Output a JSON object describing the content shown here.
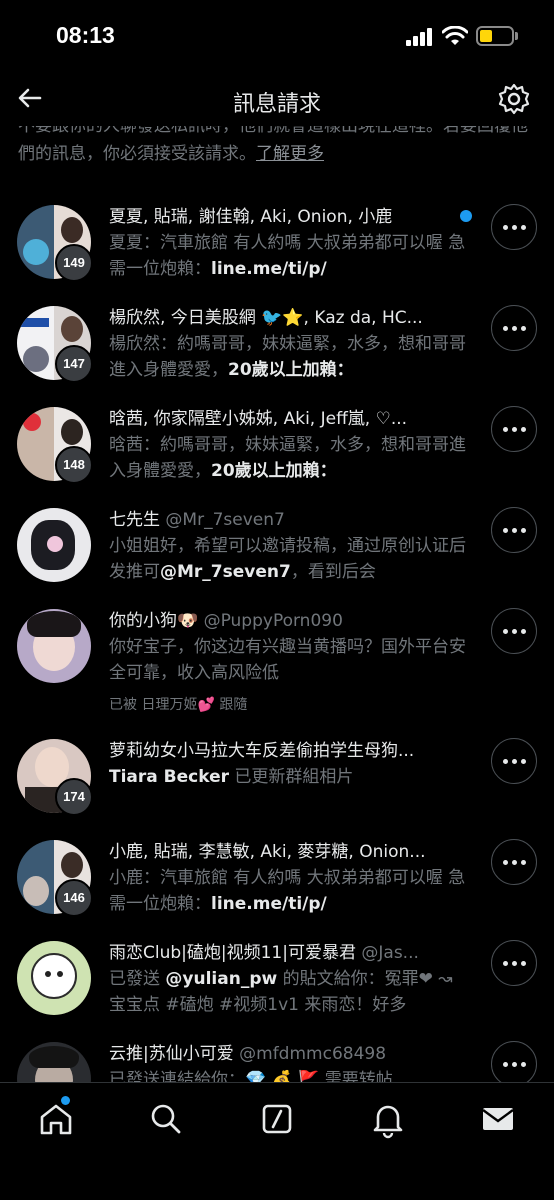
{
  "status_bar": {
    "time": "08:13"
  },
  "header": {
    "title": "訊息請求"
  },
  "notice": {
    "text": "不要跟你的人聊發送私訊時，他們就會這樣出現在這裡。若要回覆他們的訊息，你必須接受該請求。",
    "link": "了解更多"
  },
  "requests": [
    {
      "title": "夏夏, 貼瑞, 謝佳翰, Aki, Onion, 小鹿",
      "message_prefix": "夏夏：汽車旅館 有人約嗎 大叔弟弟都可以喔 急需一位炮賴：",
      "message_link": "line.me/ti/p/",
      "count": "149",
      "unread": true
    },
    {
      "title": "楊欣然, 今日美股網 🐦⭐, Kaz da, HC...",
      "message_prefix": "楊欣然：約嗎哥哥，妹妹逼緊，水多，想和哥哥進入身體愛愛，",
      "message_link": "20歲以上加賴：",
      "count": "147"
    },
    {
      "title": "晗茜, 你家隔壁小姊姊, Aki, Jeff嵐, ♡...",
      "message_prefix": "晗茜：約嗎哥哥，妹妹逼緊，水多，想和哥哥進入身體愛愛，",
      "message_link": "20歲以上加賴：",
      "count": "148"
    },
    {
      "title": "七先生",
      "handle": "@Mr_7seven7",
      "message_prefix": "小姐姐好，希望可以邀请投稿，通过原创认证后发推可",
      "message_link": "@Mr_7seven7",
      "message_suffix": "，看到后会"
    },
    {
      "title": "你的小狗🐶",
      "handle": "@PuppyPorn090",
      "message_prefix": "你好宝子，你这边有兴趣当黄播吗？国外平台安全可靠，收入高风险低",
      "followed_by": "已被 日理万姬💕 跟隨"
    },
    {
      "title": "萝莉幼女小马拉大车反差偷拍学生母狗...",
      "message_link": "Tiara Becker",
      "message_suffix": " 已更新群組相片",
      "count": "174"
    },
    {
      "title": "小鹿, 貼瑞, 李慧敏, Aki, 麥芽糖, Onion...",
      "message_prefix": "小鹿：汽車旅館 有人約嗎 大叔弟弟都可以喔 急需一位炮賴：",
      "message_link": "line.me/ti/p/",
      "count": "146"
    },
    {
      "title": "雨恋Club|磕炮|视频11|可爱暴君",
      "handle": "@Jas...",
      "message_prefix": "已發送 ",
      "message_link": "@yulian_pw",
      "message_suffix": " 的貼文給你：冤罪❤ ↝ 宝宝点 #磕炮 #视频1v1 来雨恋！好多"
    },
    {
      "title": "云推|苏仙小可爱",
      "handle": "@mfdmmc68498",
      "message_prefix": "已發送連結給你：💎 💰 🚩 需要转帖"
    }
  ],
  "bottom_nav": [
    "home-tab",
    "search-tab",
    "grok-tab",
    "notifications-tab",
    "messages-tab"
  ]
}
